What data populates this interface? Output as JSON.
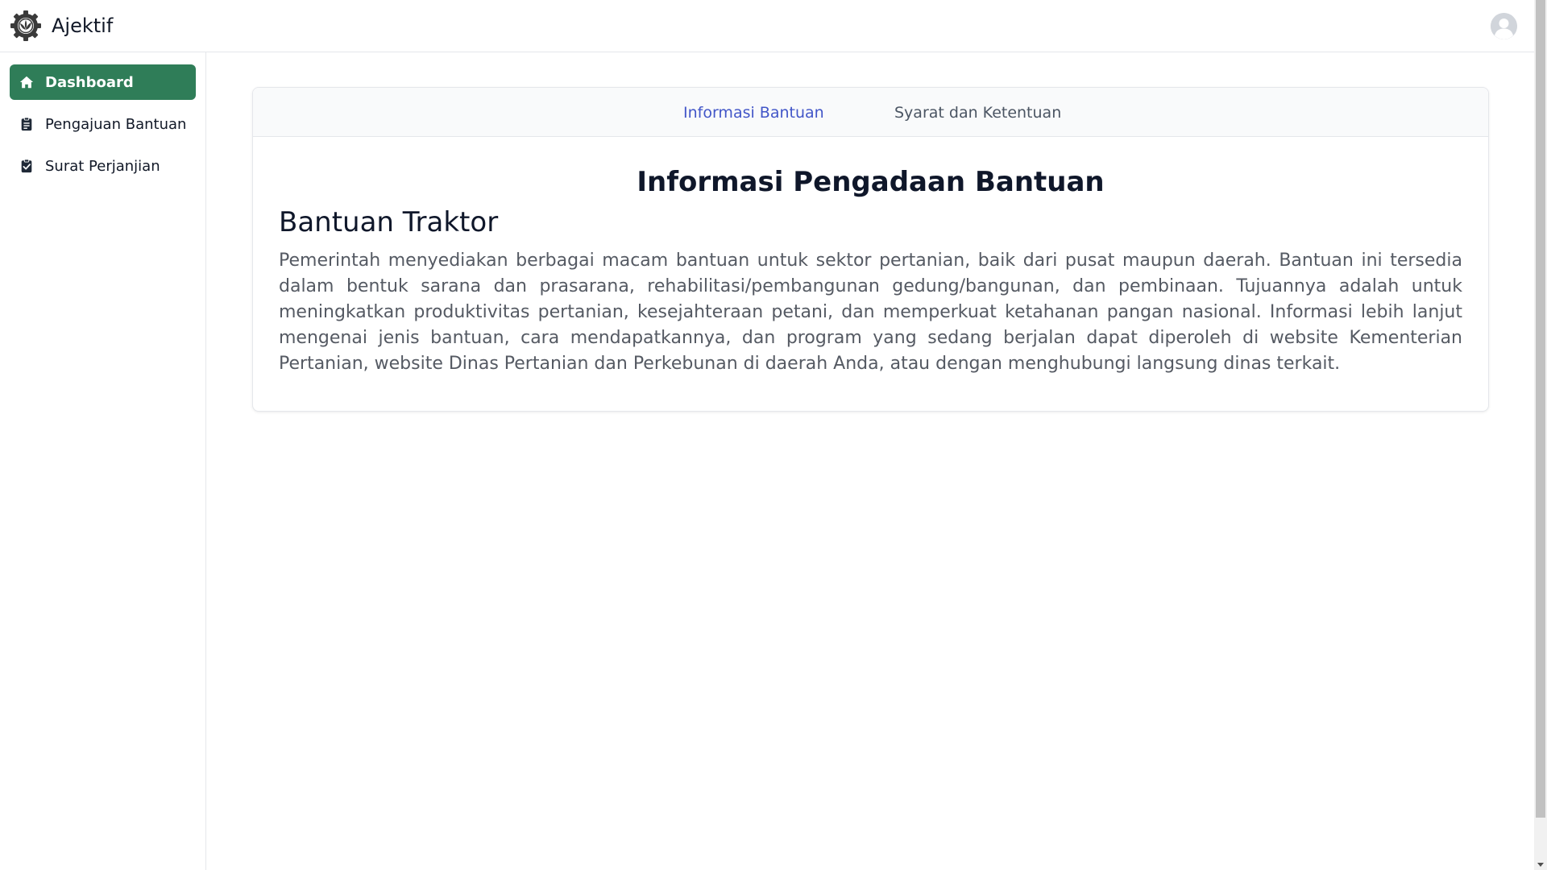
{
  "app": {
    "name": "Ajektif",
    "logo_icon": "gear-leaf-icon",
    "avatar_icon": "user-avatar-icon"
  },
  "sidebar": {
    "items": [
      {
        "label": "Dashboard",
        "icon": "home-icon",
        "active": true
      },
      {
        "label": "Pengajuan Bantuan",
        "icon": "clipboard-list-icon",
        "active": false
      },
      {
        "label": "Surat Perjanjian",
        "icon": "clipboard-check-icon",
        "active": false
      }
    ]
  },
  "main": {
    "tabs": [
      {
        "label": "Informasi Bantuan",
        "active": true
      },
      {
        "label": "Syarat dan Ketentuan",
        "active": false
      }
    ],
    "heading": "Informasi Pengadaan Bantuan",
    "subheading": "Bantuan Traktor",
    "paragraph": "Pemerintah menyediakan berbagai macam bantuan untuk sektor pertanian, baik dari pusat maupun daerah. Bantuan ini tersedia dalam bentuk sarana dan prasarana, rehabilitasi/pembangunan gedung/bangunan, dan pembinaan. Tujuannya adalah untuk meningkatkan produktivitas pertanian, kesejahteraan petani, dan memperkuat ketahanan pangan nasional. Informasi lebih lanjut mengenai jenis bantuan, cara mendapatkannya, dan program yang sedang berjalan dapat diperoleh di website Kementerian Pertanian, website Dinas Pertanian dan Perkebunan di daerah Anda, atau dengan menghubungi langsung dinas terkait."
  },
  "colors": {
    "accent_green": "#2f7d58",
    "tab_active": "#4256c8"
  }
}
